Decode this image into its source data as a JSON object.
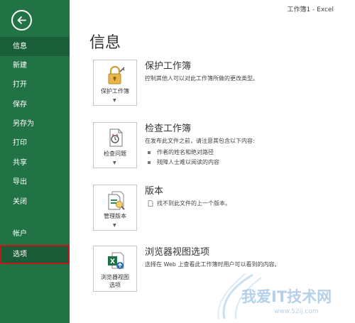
{
  "window": {
    "title": "工作簿1 - Excel"
  },
  "sidebar": {
    "items": [
      {
        "label": "信息"
      },
      {
        "label": "新建"
      },
      {
        "label": "打开"
      },
      {
        "label": "保存"
      },
      {
        "label": "另存为"
      },
      {
        "label": "打印"
      },
      {
        "label": "共享"
      },
      {
        "label": "导出"
      },
      {
        "label": "关闭"
      },
      {
        "label": "帐户"
      },
      {
        "label": "选项"
      }
    ]
  },
  "main": {
    "title": "信息",
    "sections": [
      {
        "button_label": "保护工作簿",
        "title": "保护工作簿",
        "description": "控制其他人可以对此工作簿所做的更改类型。"
      },
      {
        "button_label": "检查问题",
        "title": "检查工作簿",
        "description": "在发布此文件之前，请注意其包含以下内容:",
        "bullets": [
          "作者的姓名和绝对路径",
          "残障人士难以阅读的内容"
        ]
      },
      {
        "button_label": "管理版本",
        "title": "版本",
        "description": "找不到此文件的上一个版本。"
      },
      {
        "button_label_1": "浏览器视图",
        "button_label_2": "选项",
        "title": "浏览器视图选项",
        "description": "选择在 Web 上查看此工作簿时用户可以看到的内容。"
      }
    ]
  },
  "watermark": {
    "text": "我爱IT技术网",
    "url": "www.52ij.com"
  },
  "colors": {
    "sidebar": "#217346",
    "selected_border": "#c0181d"
  }
}
